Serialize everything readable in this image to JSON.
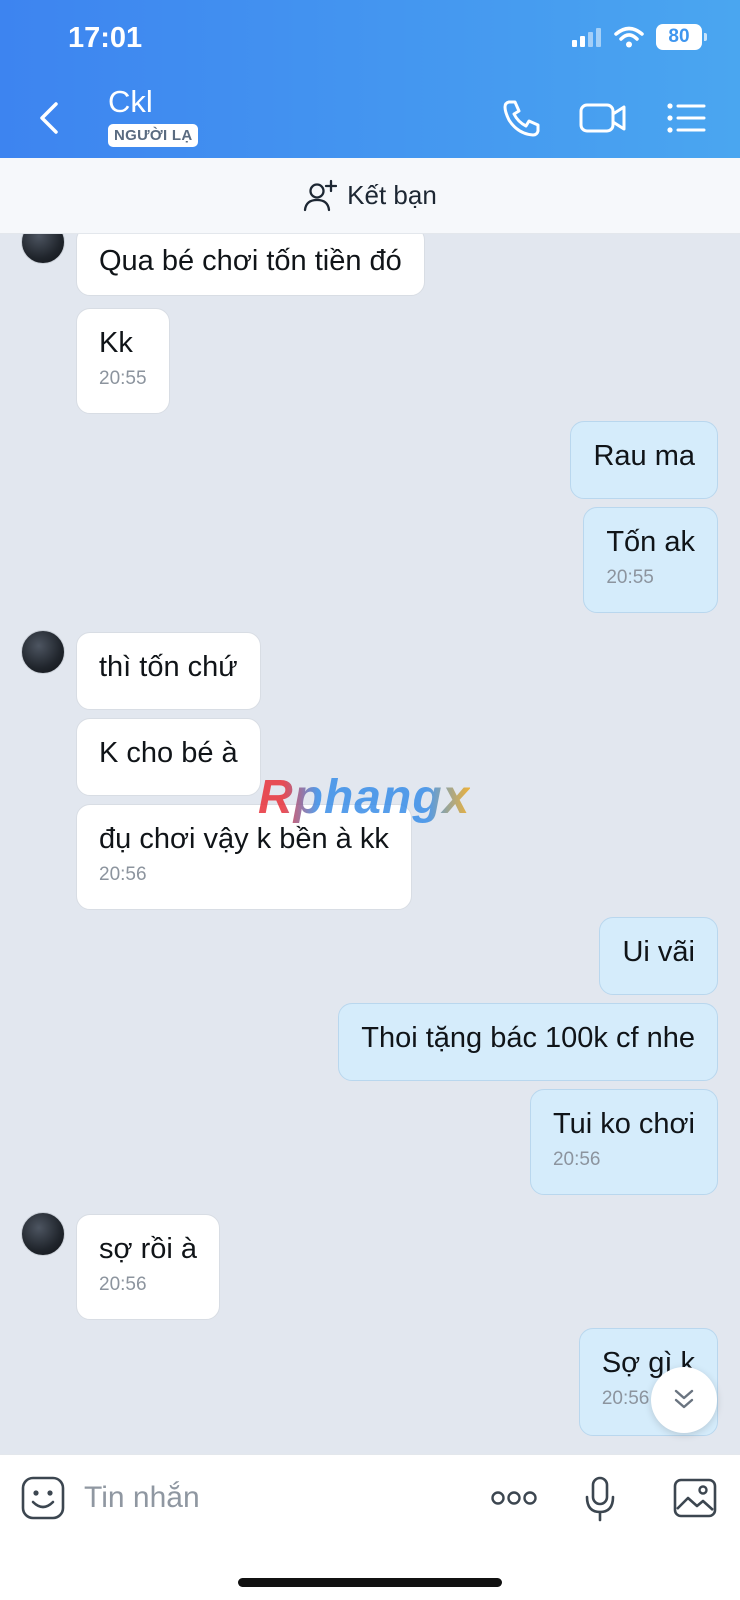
{
  "status_bar": {
    "time": "17:01",
    "battery": "80"
  },
  "header": {
    "contact_name": "Ckl",
    "badge": "NGƯỜI LẠ"
  },
  "add_friend": {
    "label": "Kết bạn"
  },
  "messages": [
    {
      "side": "in",
      "text": "Qua bé chơi tốn tiền đó",
      "time": ""
    },
    {
      "side": "in",
      "text": "Kk",
      "time": "20:55"
    },
    {
      "side": "out",
      "text": "Rau ma",
      "time": ""
    },
    {
      "side": "out",
      "text": "Tốn ak",
      "time": "20:55"
    },
    {
      "side": "in",
      "text": "thì tốn chứ",
      "time": ""
    },
    {
      "side": "in",
      "text": "K cho bé à",
      "time": ""
    },
    {
      "side": "in",
      "text": "đụ chơi vậy k bền à kk",
      "time": "20:56"
    },
    {
      "side": "out",
      "text": "Ui vãi",
      "time": ""
    },
    {
      "side": "out",
      "text": "Thoi tặng bác 100k cf nhe",
      "time": ""
    },
    {
      "side": "out",
      "text": "Tui ko chơi",
      "time": "20:56"
    },
    {
      "side": "in",
      "text": "sợ rồi à",
      "time": "20:56"
    },
    {
      "side": "out",
      "text": "Sợ gì k",
      "time": "20:56"
    }
  ],
  "watermark": "Rphangx",
  "input": {
    "placeholder": "Tin nhắn"
  },
  "icons": {
    "back": "chevron-left-icon",
    "call": "phone-icon",
    "video": "video-camera-icon",
    "menu": "list-menu-icon",
    "add_friend": "add-user-icon",
    "sticker": "sticker-icon",
    "more": "more-dots-icon",
    "mic": "microphone-icon",
    "image": "image-icon",
    "scroll": "chevron-double-down-icon"
  },
  "colors": {
    "header_start": "#3d84f0",
    "header_end": "#4aa6f0",
    "chat_bg": "#e2e7ef",
    "incoming_bubble": "#ffffff",
    "outgoing_bubble": "#d5ecfb"
  }
}
